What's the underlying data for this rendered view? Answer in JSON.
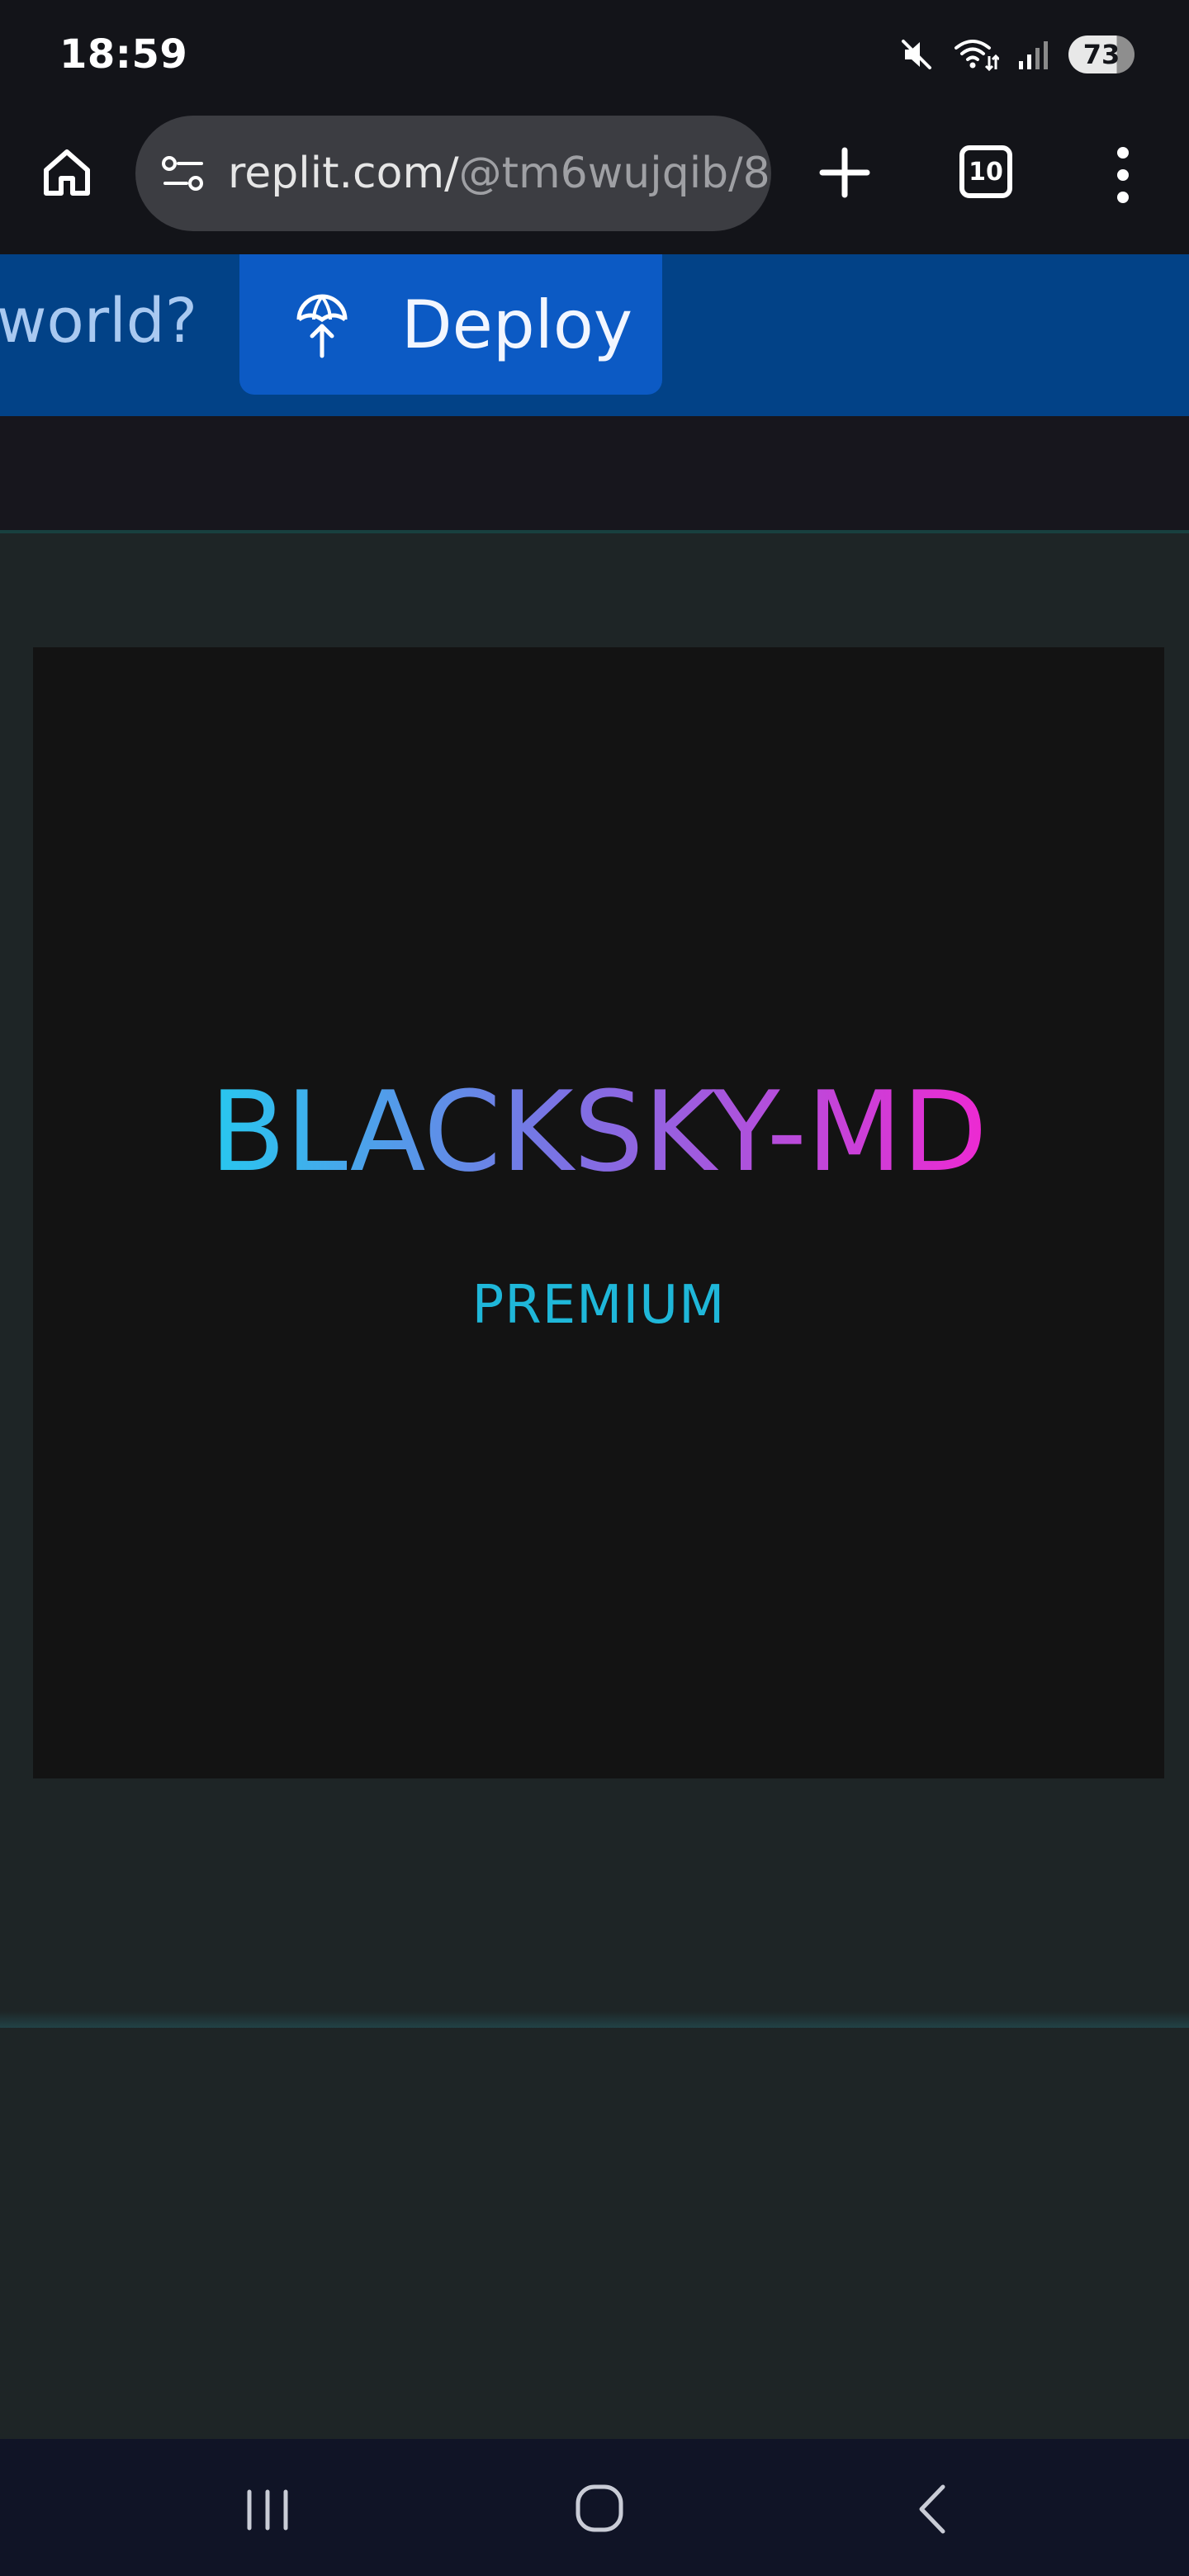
{
  "status_bar": {
    "time": "18:59",
    "battery": "73"
  },
  "browser": {
    "url_host": "replit.com/",
    "url_path": "@tm6wujqib/8",
    "tab_count": "10"
  },
  "banner": {
    "partial_text": "world?",
    "deploy_label": "Deploy",
    "colors": {
      "banner_bg": "#024287",
      "button_bg": "#0c5ac4"
    }
  },
  "app": {
    "logo_title": "BLACKSKY-MD",
    "logo_subtitle": "PREMIUM",
    "colors": {
      "gradient_start": "#27c8ef",
      "gradient_end": "#ee29d2",
      "subtitle": "#1fb7d9"
    }
  },
  "icons": {
    "status": [
      "mute-icon",
      "wifi-icon",
      "signal-icon"
    ],
    "browser": [
      "home-icon",
      "site-settings-icon",
      "new-tab-icon",
      "tab-switcher-icon",
      "more-menu-icon"
    ],
    "banner": [
      "deploy-icon"
    ],
    "nav": [
      "recent-apps-icon",
      "home-nav-icon",
      "back-icon"
    ]
  }
}
